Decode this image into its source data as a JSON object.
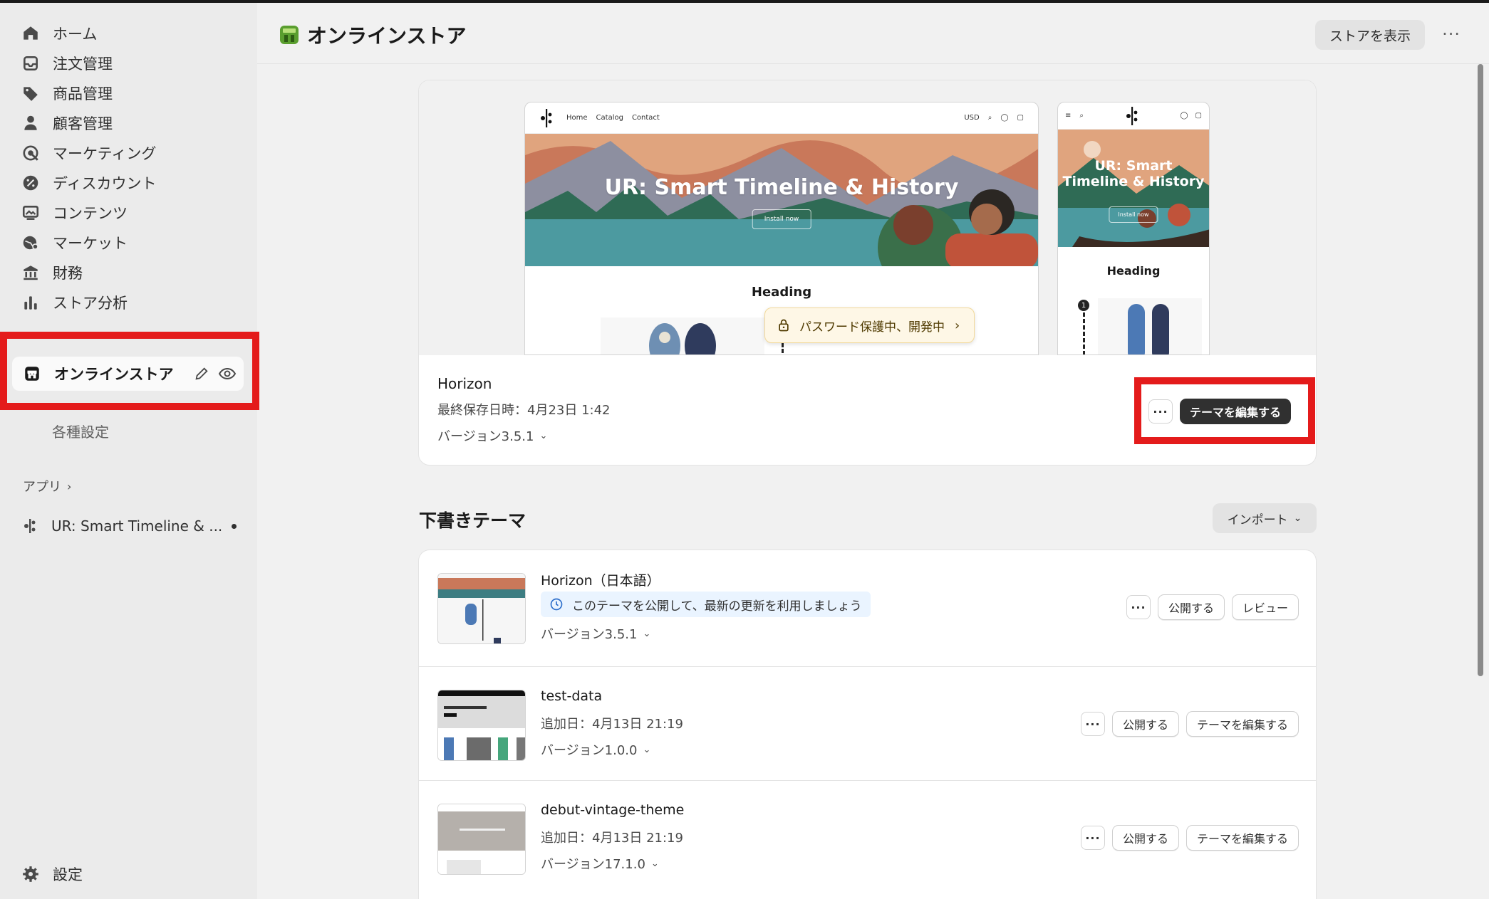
{
  "sidebar": {
    "nav": [
      {
        "label": "ホーム",
        "icon": "home-icon"
      },
      {
        "label": "注文管理",
        "icon": "inbox-icon"
      },
      {
        "label": "商品管理",
        "icon": "tag-icon"
      },
      {
        "label": "顧客管理",
        "icon": "person-icon"
      },
      {
        "label": "マーケティング",
        "icon": "target-icon"
      },
      {
        "label": "ディスカウント",
        "icon": "discount-icon"
      },
      {
        "label": "コンテンツ",
        "icon": "image-icon"
      },
      {
        "label": "マーケット",
        "icon": "globe-icon"
      },
      {
        "label": "財務",
        "icon": "bank-icon"
      },
      {
        "label": "ストア分析",
        "icon": "chart-icon"
      }
    ],
    "online_store": "オンラインストア",
    "settings_sub": "各種設定",
    "apps_label": "アプリ",
    "app_item": "UR: Smart Timeline & ...",
    "settings": "設定"
  },
  "header": {
    "title": "オンラインストア",
    "view_store": "ストアを表示",
    "more": "···"
  },
  "current_theme": {
    "preview": {
      "nav_links": [
        "Home",
        "Catalog",
        "Contact"
      ],
      "currency": "USD",
      "hero_title": "UR: Smart Timeline & History",
      "mobile_hero_title_1": "UR: Smart",
      "mobile_hero_title_2": "Timeline & History",
      "hero_button": "Install now",
      "heading": "Heading",
      "step_number": "1"
    },
    "password_badge": "パスワード保護中、開発中",
    "name": "Horizon",
    "saved": "最終保存日時：4月23日 1:42",
    "version": "バージョン3.5.1",
    "edit_label": "テーマを編集する",
    "more": "···"
  },
  "drafts": {
    "title": "下書きテーマ",
    "import": "インポート",
    "rows": [
      {
        "name": "Horizon（日本語）",
        "note": "このテーマを公開して、最新の更新を利用しましょう",
        "version": "バージョン3.5.1",
        "publish": "公開する",
        "review": "レビュー",
        "more": "···"
      },
      {
        "name": "test-data",
        "added": "追加日：4月13日 21:19",
        "version": "バージョン1.0.0",
        "publish": "公開する",
        "edit": "テーマを編集する",
        "more": "···"
      },
      {
        "name": "debut-vintage-theme",
        "added": "追加日：4月13日 21:19",
        "version": "バージョン17.1.0",
        "publish": "公開する",
        "edit": "テーマを編集する",
        "more": "···"
      }
    ]
  },
  "colors": {
    "highlight": "#e41b1b",
    "dark_button": "#303030",
    "password_badge_bg": "#fef7e6",
    "note_bg": "#eaf4ff"
  }
}
